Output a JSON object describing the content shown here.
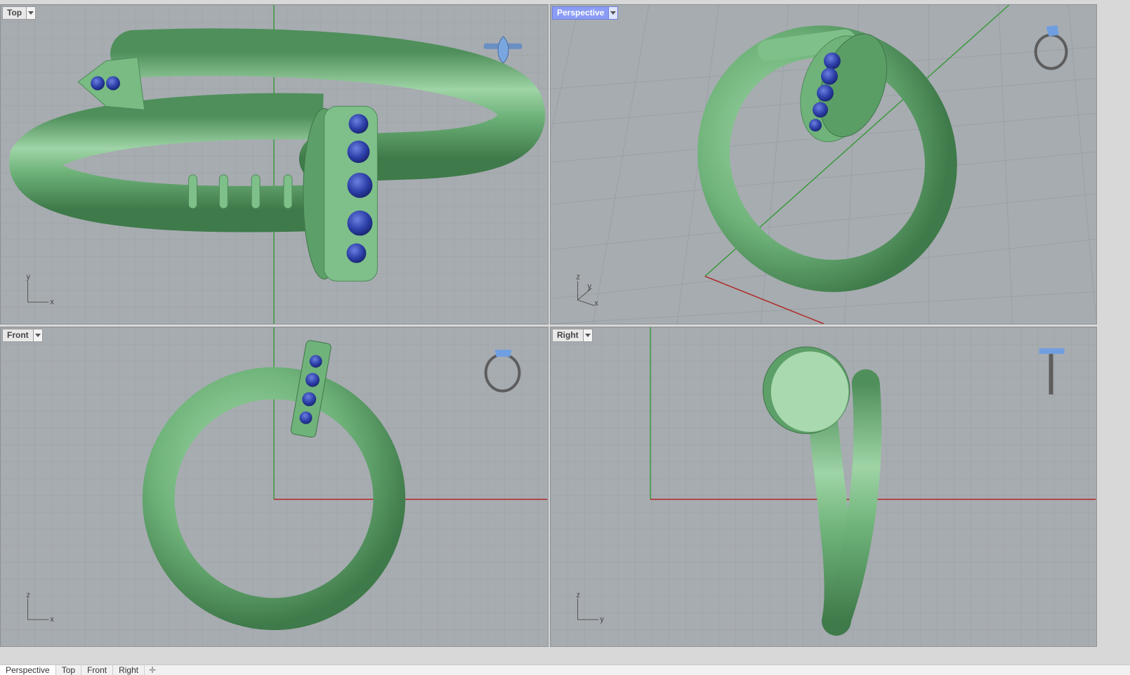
{
  "viewports": {
    "top": {
      "label": "Top",
      "axis_a": "y",
      "axis_b": "x"
    },
    "perspective": {
      "label": "Perspective",
      "axis_a": "z",
      "axis_b": "y",
      "axis_c": "x"
    },
    "front": {
      "label": "Front",
      "axis_a": "z",
      "axis_b": "x"
    },
    "right": {
      "label": "Right",
      "axis_a": "z",
      "axis_b": "y"
    }
  },
  "tabs": [
    "Perspective",
    "Top",
    "Front",
    "Right"
  ],
  "add_tab_icon": "plus-icon",
  "colors": {
    "viewport_bg": "#a7acb1",
    "grid_line": "#9ba0a5",
    "grid_major": "#8f9499",
    "model_green": "#6fb37a",
    "gem_blue": "#2c3fa8",
    "axis_red": "#b02a24",
    "axis_green": "#3a9a3a",
    "active_label": "#8a9cf5"
  }
}
